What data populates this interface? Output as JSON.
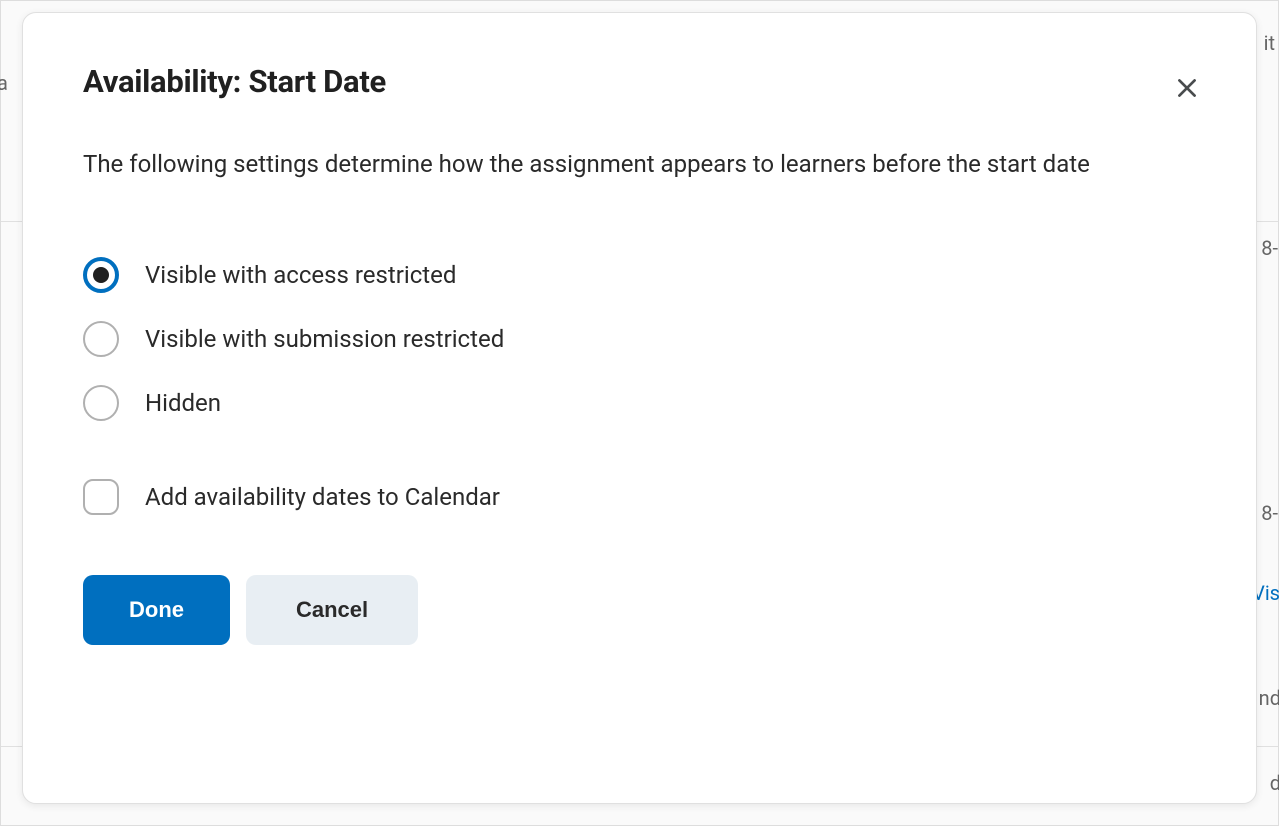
{
  "modal": {
    "title": "Availability: Start Date",
    "description": "The following settings determine how the assignment appears to learners before the start date",
    "options": [
      {
        "label": "Visible with access restricted",
        "selected": true
      },
      {
        "label": "Visible with submission restricted",
        "selected": false
      },
      {
        "label": "Hidden",
        "selected": false
      }
    ],
    "checkbox": {
      "label": "Add availability dates to Calendar",
      "checked": false
    },
    "buttons": {
      "primary": "Done",
      "secondary": "Cancel"
    }
  },
  "backdrop": {
    "fragments": [
      "it",
      "a",
      "8-",
      ":",
      "8-",
      "Vis",
      "nd",
      "d"
    ]
  }
}
